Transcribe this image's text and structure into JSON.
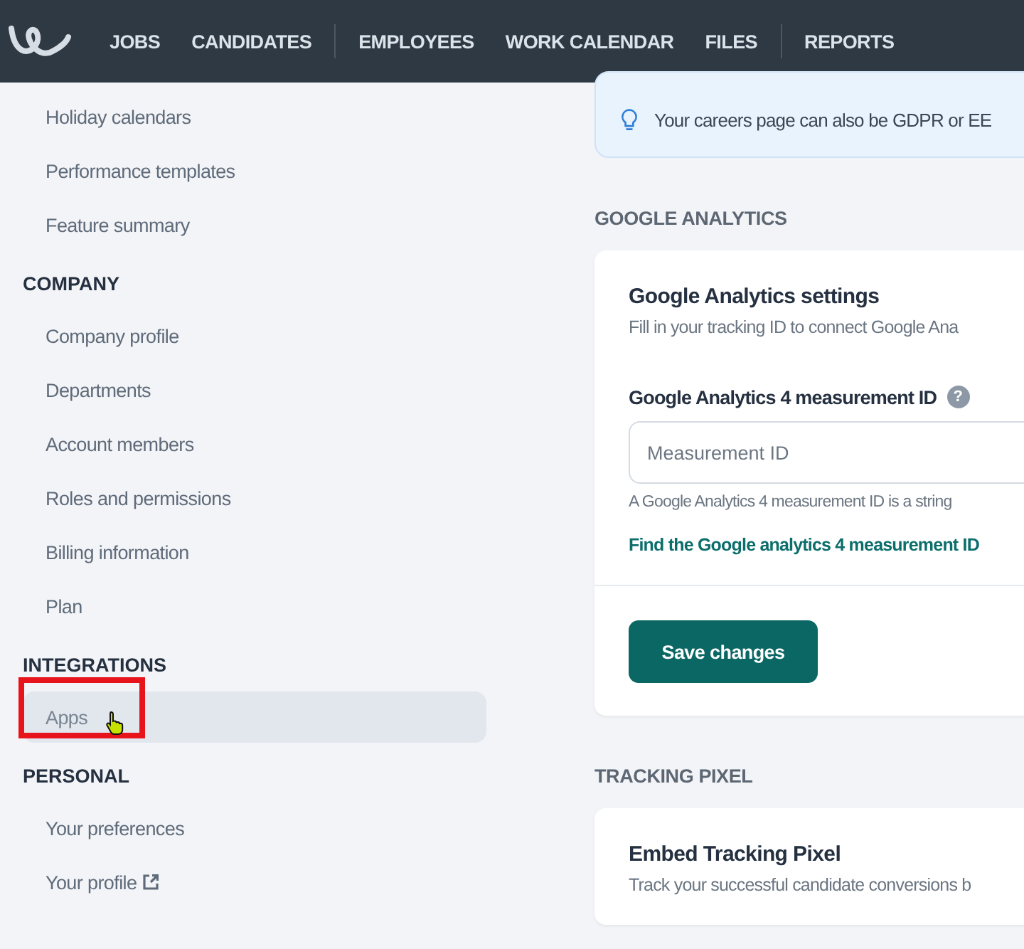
{
  "nav": {
    "items": [
      {
        "label": "JOBS",
        "selected": false,
        "divider_after": false
      },
      {
        "label": "CANDIDATES",
        "selected": false,
        "divider_after": true
      },
      {
        "label": "EMPLOYEES",
        "selected": false,
        "divider_after": false
      },
      {
        "label": "WORK CALENDAR",
        "selected": false,
        "divider_after": false
      },
      {
        "label": "FILES",
        "selected": false,
        "divider_after": true
      },
      {
        "label": "REPORTS",
        "selected": false,
        "divider_after": false
      }
    ]
  },
  "sidebar": {
    "groups": [
      {
        "items": [
          {
            "label": "Holiday calendars",
            "selected": false,
            "external": false
          },
          {
            "label": "Performance templates",
            "selected": false,
            "external": false
          },
          {
            "label": "Feature summary",
            "selected": false,
            "external": false
          }
        ]
      },
      {
        "heading": "COMPANY",
        "items": [
          {
            "label": "Company profile",
            "selected": false,
            "external": false
          },
          {
            "label": "Departments",
            "selected": false,
            "external": false
          },
          {
            "label": "Account members",
            "selected": false,
            "external": false
          },
          {
            "label": "Roles and permissions",
            "selected": false,
            "external": false
          },
          {
            "label": "Billing information",
            "selected": false,
            "external": false
          },
          {
            "label": "Plan",
            "selected": false,
            "external": false
          }
        ]
      },
      {
        "heading": "INTEGRATIONS",
        "items": [
          {
            "label": "Apps",
            "selected": true,
            "external": false
          }
        ]
      },
      {
        "heading": "PERSONAL",
        "items": [
          {
            "label": "Your preferences",
            "selected": false,
            "external": false
          },
          {
            "label": "Your profile",
            "selected": false,
            "external": true
          }
        ]
      }
    ]
  },
  "info_banner": {
    "text": "Your careers page can also be GDPR or EE"
  },
  "sections": [
    {
      "heading": "GOOGLE ANALYTICS",
      "card": {
        "title": "Google Analytics settings",
        "description": "Fill in your tracking ID to connect Google Ana",
        "field": {
          "label": "Google Analytics 4 measurement ID",
          "help_icon": "?",
          "placeholder": "Measurement ID",
          "help": "A Google Analytics 4 measurement ID is a string"
        },
        "link": "Find the Google analytics 4 measurement ID",
        "button": "Save changes"
      }
    },
    {
      "heading": "TRACKING PIXEL",
      "card": {
        "title": "Embed Tracking Pixel",
        "description": "Track your successful candidate conversions b"
      }
    }
  ]
}
